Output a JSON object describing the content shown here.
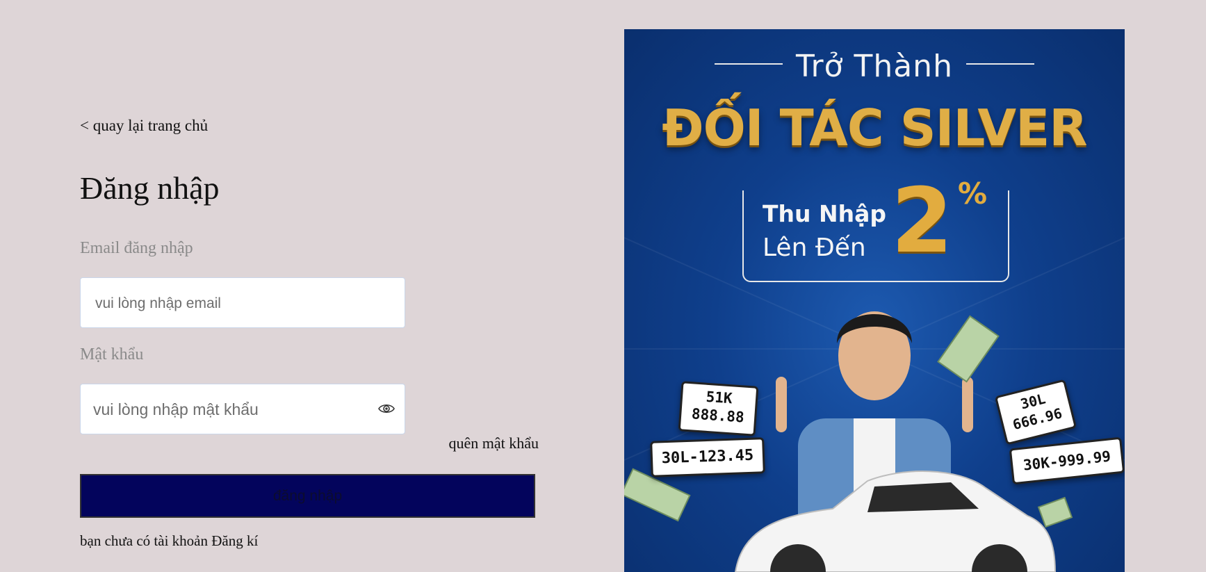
{
  "page": {
    "back_link": "< quay lại trang chủ",
    "title": "Đăng nhập"
  },
  "form": {
    "email_label": "Email đăng nhập",
    "email_placeholder": "vui lòng nhập email",
    "password_label": "Mật khẩu",
    "password_placeholder": "vui lòng nhập mật khẩu",
    "forgot_password": "quên mật khẩu",
    "submit_label": "đăng nhập",
    "no_account_text": "bạn chưa có tài khoản",
    "signup_link": "Đăng kí",
    "eye_icon": "eye-icon"
  },
  "banner": {
    "kicker": "Trở Thành",
    "headline": "ĐỐI TÁC SILVER",
    "income_line1": "Thu Nhập",
    "income_line2": "Lên Đến",
    "income_value": "2",
    "income_unit": "%",
    "plates": [
      "51K\n888.88",
      "30L-123.45",
      "30L\n666.96",
      "30K-999.99"
    ],
    "colors": {
      "background": "#0f3f8c",
      "gold": "#e0ae46"
    }
  },
  "colors": {
    "page_background": "#ded5d7",
    "button_background": "#03045c"
  }
}
